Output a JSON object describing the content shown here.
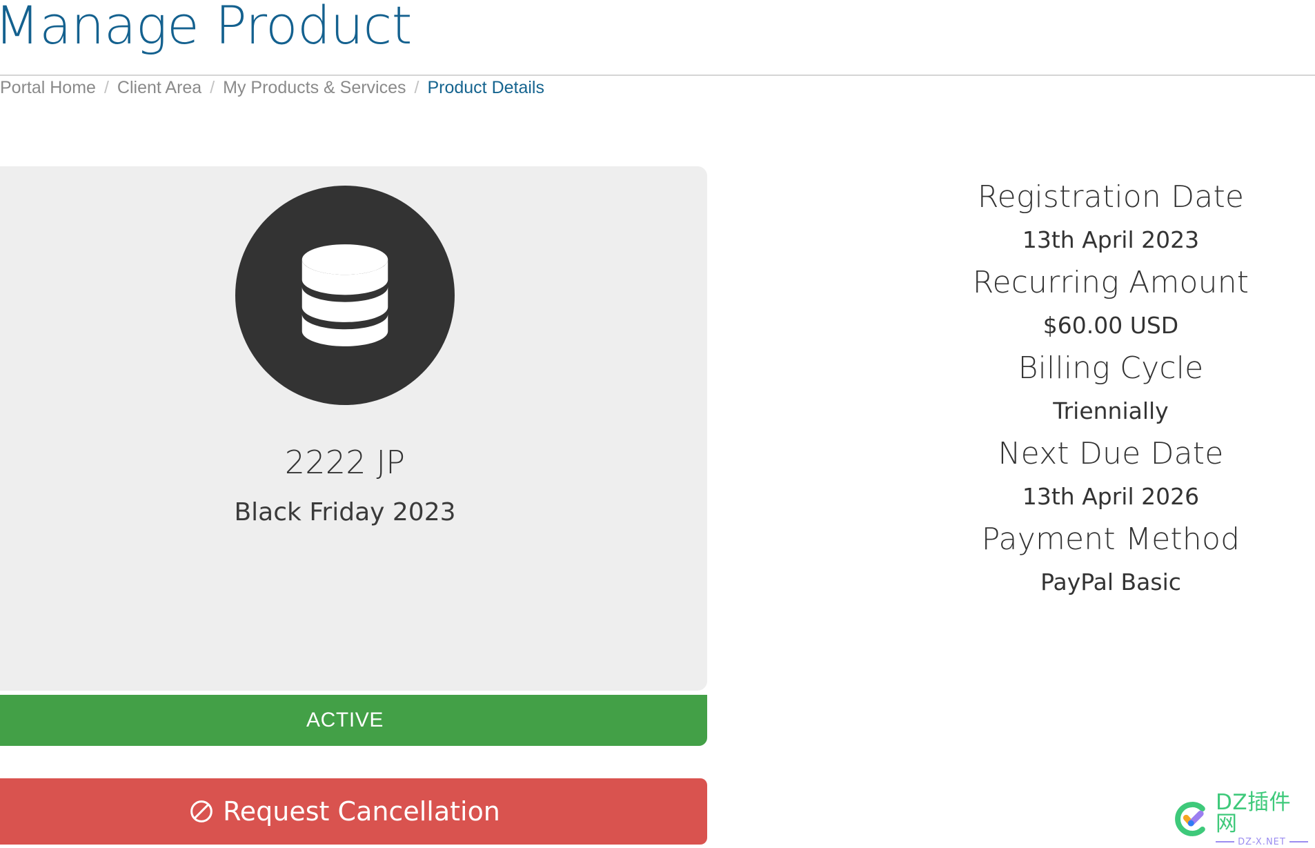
{
  "header": {
    "title": "Manage Product"
  },
  "breadcrumb": {
    "separator": "/",
    "items": [
      {
        "label": "Portal Home",
        "active": false
      },
      {
        "label": "Client Area",
        "active": false
      },
      {
        "label": "My Products & Services",
        "active": false
      },
      {
        "label": "Product Details",
        "active": true
      }
    ]
  },
  "product_card": {
    "icon": "database-icon",
    "name": "2222 JP",
    "group": "Black Friday 2023",
    "status": {
      "label": "ACTIVE",
      "color": "#43a047"
    }
  },
  "actions": {
    "cancel": {
      "label": "Request Cancellation",
      "icon": "ban-icon",
      "color": "#d9534f"
    }
  },
  "details": {
    "fields": [
      {
        "label": "Registration Date",
        "value": "13th April 2023"
      },
      {
        "label": "Recurring Amount",
        "value": "$60.00 USD"
      },
      {
        "label": "Billing Cycle",
        "value": "Triennially"
      },
      {
        "label": "Next Due Date",
        "value": "13th April 2026"
      },
      {
        "label": "Payment Method",
        "value": "PayPal Basic"
      }
    ]
  },
  "watermark": {
    "icon": "check-circle-logo-icon",
    "main_text": "DZ插件网",
    "sub_text": "DZ-X.NET"
  },
  "colors": {
    "title_blue": "#14618f",
    "link_blue": "#15648f",
    "muted_gray": "#8a8a8a",
    "card_bg": "#eeeeee",
    "icon_circle": "#333333",
    "status_green": "#43a047",
    "danger_red": "#d9534f",
    "watermark_green": "#3ec97a",
    "watermark_purple": "#9b8cf0"
  }
}
